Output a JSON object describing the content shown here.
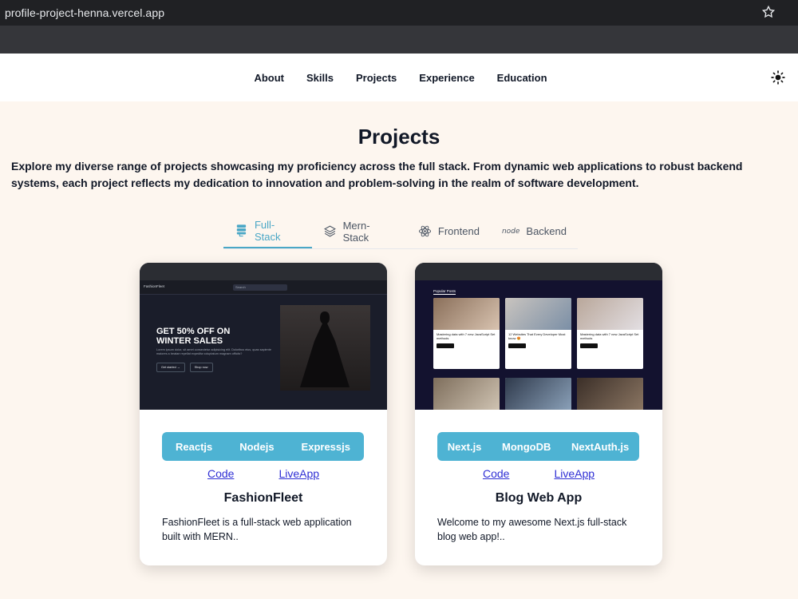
{
  "browser": {
    "url": "profile-project-henna.vercel.app"
  },
  "nav": {
    "items": [
      "About",
      "Skills",
      "Projects",
      "Experience",
      "Education"
    ]
  },
  "section": {
    "title": "Projects",
    "description": "Explore my diverse range of projects showcasing my proficiency across the full stack. From dynamic web applications to robust backend systems, each project reflects my dedication to innovation and problem-solving in the realm of software development."
  },
  "tabs": [
    {
      "label": "Full-Stack",
      "icon": "server-stack-icon",
      "active": true
    },
    {
      "label": "Mern-Stack",
      "icon": "layers-icon",
      "active": false
    },
    {
      "label": "Frontend",
      "icon": "react-icon",
      "active": false
    },
    {
      "label": "Backend",
      "icon": "node-icon",
      "active": false
    }
  ],
  "projects": [
    {
      "title": "FashionFleet",
      "description": "FashionFleet is a full-stack web application built with MERN..",
      "tech": [
        "Reactjs",
        "Nodejs",
        "Expressjs"
      ],
      "code_label": "Code",
      "live_label": "LiveApp",
      "screenshot": {
        "brand": "FashionFleet",
        "search_placeholder": "Search",
        "hero_title_line1": "GET 50% OFF ON",
        "hero_title_line2": "WINTER SALES",
        "hero_text": "Lorem ipsum dolor, sit amet consectetur adipisicing elit. Doloribus eius, quas sapiente maiores a beatae repellat expedita voluptatum magnam officiis?",
        "btn_primary": "Get started →",
        "btn_secondary": "Shop now"
      }
    },
    {
      "title": "Blog Web App",
      "description": "Welcome to my awesome Next.js full-stack blog web app!..",
      "tech": [
        "Next.js",
        "MongoDB",
        "NextAuth.js"
      ],
      "code_label": "Code",
      "live_label": "LiveApp",
      "screenshot": {
        "section_label": "Popular Posts",
        "post1": "Mastering data with 7 new JavaScript Set methods",
        "post2": "12 Websites That Every Developer Must know 😍",
        "post3": "Mastering data with 7 new JavaScript Set methods"
      }
    }
  ]
}
